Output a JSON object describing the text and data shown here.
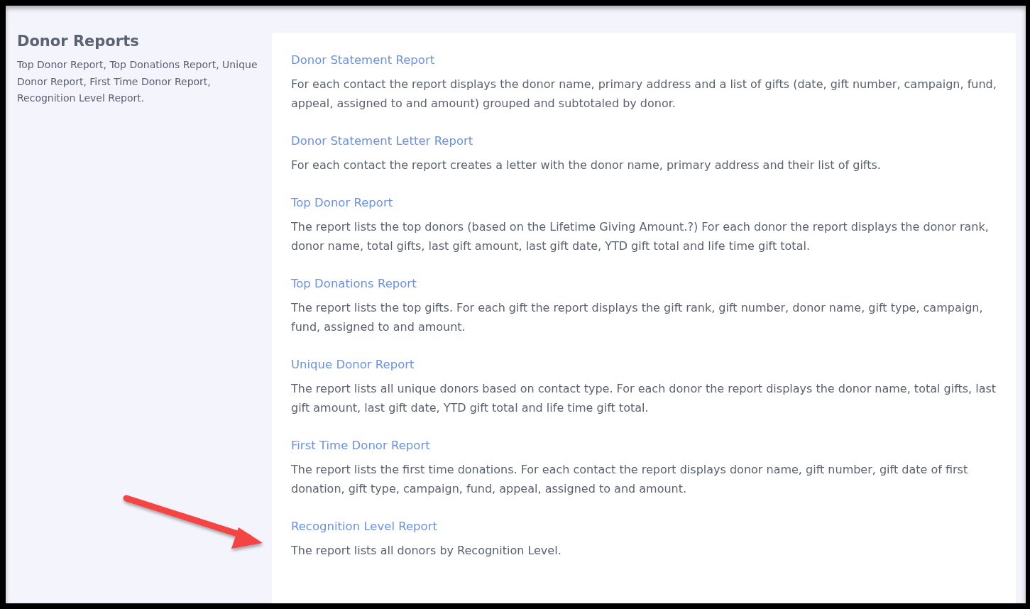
{
  "sidebar": {
    "title": "Donor Reports",
    "summary": "Top Donor Report, Top Donations Report, Unique Donor Report, First Time Donor Report, Recognition Level Report."
  },
  "reports": [
    {
      "title": "Donor Statement Report",
      "description": "For each contact the report displays the donor name, primary address and a list of gifts (date, gift number, campaign, fund, appeal, assigned to and amount) grouped and subtotaled by donor."
    },
    {
      "title": "Donor Statement Letter Report",
      "description": "For each contact the report creates a letter with the donor name, primary address and their list of gifts."
    },
    {
      "title": "Top Donor Report",
      "description": "The report lists the top donors (based on the Lifetime Giving Amount.?) For each donor the report displays the donor rank, donor name, total gifts, last gift amount, last gift date, YTD gift total and life time gift total."
    },
    {
      "title": "Top Donations Report",
      "description": "The report lists the top gifts. For each gift the report displays the gift rank, gift number, donor name, gift type, campaign, fund, assigned to and amount."
    },
    {
      "title": "Unique Donor Report",
      "description": "The report lists all unique donors based on contact type. For each donor the report displays the donor name, total gifts, last gift amount, last gift date, YTD gift total and life time gift total."
    },
    {
      "title": "First Time Donor Report",
      "description": "The report lists the first time donations. For each contact the report displays donor name, gift number, gift date of first donation, gift type, campaign, fund, appeal, assigned to and amount."
    },
    {
      "title": "Recognition Level Report",
      "description": "The report lists all donors by Recognition Level."
    }
  ]
}
